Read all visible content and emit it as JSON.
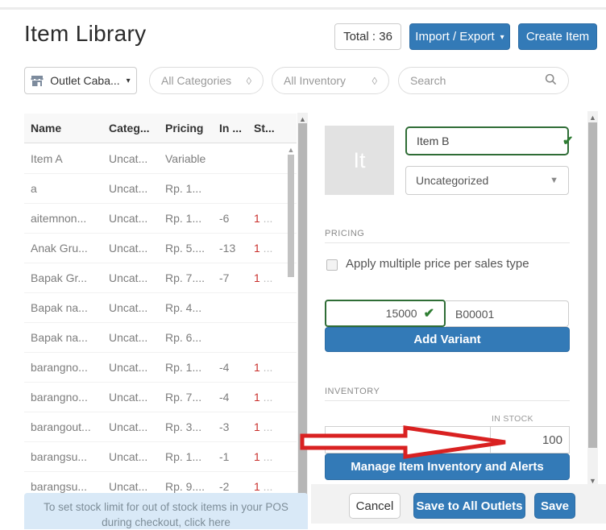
{
  "page": {
    "title": "Item Library"
  },
  "header": {
    "total_label": "Total : 36",
    "import_export_label": "Import / Export",
    "create_item_label": "Create Item"
  },
  "filters": {
    "outlet_label": "Outlet Caba...",
    "categories_label": "All Categories",
    "inventory_label": "All Inventory",
    "search_placeholder": "Search"
  },
  "table": {
    "columns": [
      "Name",
      "Categ...",
      "Pricing",
      "In ...",
      "St..."
    ],
    "rows": [
      {
        "name": "Item A",
        "category": "Uncat...",
        "pricing": "Variable",
        "in_col": "",
        "stock_alert": "",
        "ellipsis": ""
      },
      {
        "name": "a",
        "category": "Uncat...",
        "pricing": "Rp. 1...",
        "in_col": "",
        "stock_alert": "",
        "ellipsis": ""
      },
      {
        "name": "aitemnon...",
        "category": "Uncat...",
        "pricing": "Rp. 1...",
        "in_col": "-6",
        "stock_alert": "1",
        "ellipsis": " ..."
      },
      {
        "name": "Anak Gru...",
        "category": "Uncat...",
        "pricing": "Rp. 5....",
        "in_col": "-13",
        "stock_alert": "1",
        "ellipsis": " ..."
      },
      {
        "name": "Bapak Gr...",
        "category": "Uncat...",
        "pricing": "Rp. 7....",
        "in_col": "-7",
        "stock_alert": "1",
        "ellipsis": " ..."
      },
      {
        "name": "Bapak na...",
        "category": "Uncat...",
        "pricing": "Rp. 4...",
        "in_col": "",
        "stock_alert": "",
        "ellipsis": ""
      },
      {
        "name": "Bapak na...",
        "category": "Uncat...",
        "pricing": "Rp. 6...",
        "in_col": "",
        "stock_alert": "",
        "ellipsis": ""
      },
      {
        "name": "barangno...",
        "category": "Uncat...",
        "pricing": "Rp. 1...",
        "in_col": "-4",
        "stock_alert": "1",
        "ellipsis": " ..."
      },
      {
        "name": "barangno...",
        "category": "Uncat...",
        "pricing": "Rp. 7...",
        "in_col": "-4",
        "stock_alert": "1",
        "ellipsis": " ..."
      },
      {
        "name": "barangout...",
        "category": "Uncat...",
        "pricing": "Rp. 3...",
        "in_col": "-3",
        "stock_alert": "1",
        "ellipsis": " ..."
      },
      {
        "name": "barangsu...",
        "category": "Uncat...",
        "pricing": "Rp. 1...",
        "in_col": "-1",
        "stock_alert": "1",
        "ellipsis": " ..."
      },
      {
        "name": "barangsu...",
        "category": "Uncat...",
        "pricing": "Rp. 9....",
        "in_col": "-2",
        "stock_alert": "1",
        "ellipsis": " ..."
      }
    ]
  },
  "banner": {
    "line1": "To set stock limit for out of stock items in your POS",
    "line2": "during checkout, click here"
  },
  "detail": {
    "image_placeholder": "It",
    "item_name": "Item B",
    "category_value": "Uncategorized",
    "pricing_section_label": "PRICING",
    "multi_price_label": "Apply multiple price per sales type",
    "price_value": "15000",
    "sku_value": "B00001",
    "add_variant_label": "Add Variant",
    "inventory_section_label": "INVENTORY",
    "in_stock_label": "IN STOCK",
    "in_stock_value": "100",
    "manage_inventory_label": "Manage Item Inventory and Alerts"
  },
  "footer": {
    "cancel_label": "Cancel",
    "save_all_label": "Save to All Outlets",
    "save_label": "Save"
  },
  "icons": {
    "check": "✔",
    "caret_down": "▾",
    "selector_diamond": "◊",
    "scroll_up": "▲",
    "scroll_down": "▼"
  },
  "colors": {
    "primary_blue": "#337ab7",
    "success_green": "#2e7d32",
    "alert_red": "#c9302c",
    "annotation_arrow_red": "#d92121",
    "banner_bg": "#d9e9f7"
  }
}
